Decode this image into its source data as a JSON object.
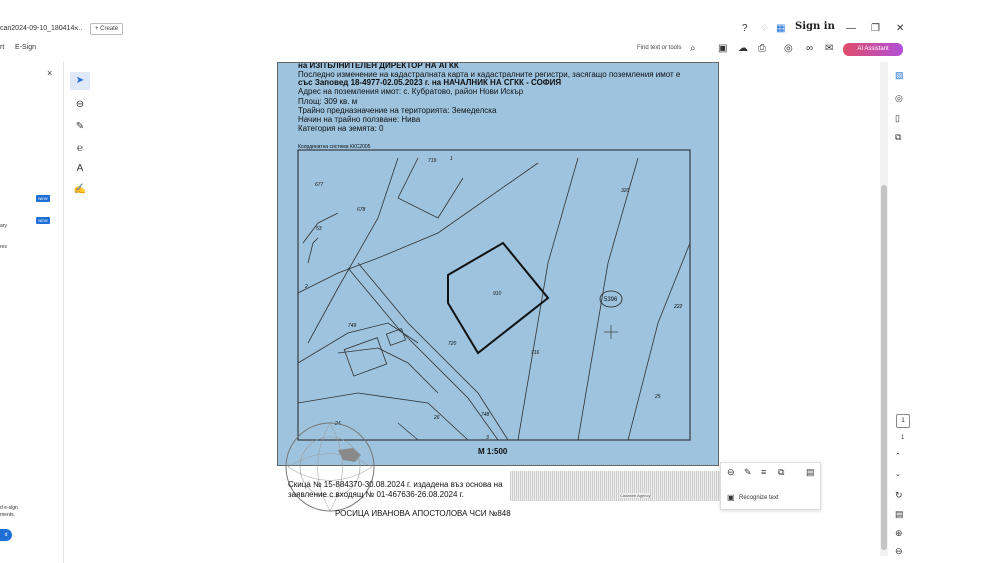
{
  "tab": {
    "title": "can2024-09-10_180414-...",
    "close": "×"
  },
  "create_label": "+ Create",
  "titlebar": {
    "sign_in": "Sign in",
    "min": "—",
    "max": "❐",
    "close": "✕"
  },
  "menu": {
    "items": [
      "rt",
      "E-Sign"
    ],
    "find_text": "Find text or tools",
    "ai_label": "AI Assistant"
  },
  "left_panel": {
    "close": "×",
    "new_badge_1": "NEW",
    "new_badge_2": "NEW",
    "row_1": "ary",
    "row_2": "res",
    "footer_1": "d e-sign",
    "footer_2": "ments.",
    "footer_btn": "d"
  },
  "document": {
    "lines": [
      "на ИЗПЪЛНИТЕЛЕН ДИРЕКТОР НА АГКК",
      "Последно изменение на кадастралната карта и кадастралните регистри, засягащо поземления имот е",
      "със Заповед 18-4977-02.05.2023 г. на НАЧАЛНИК НА СГКК - СОФИЯ",
      "Адрес на поземления имот: с. Кубратово, район Нови Искър",
      "Площ: 309 кв. м",
      "Трайно предназначение на територията: Земеделска",
      "Начин на трайно ползване: Нива",
      "Категория на земята: 0"
    ],
    "coord_system": "Координатна система ККС2005",
    "labels": {
      "l719": "719",
      "l1": "1",
      "l677": "677",
      "l678": "678",
      "l53": "53",
      "l320": "320",
      "l910": "910",
      "l5396": "5396",
      "l222": "222",
      "l2": "2",
      "l749": "749",
      "l720": "720",
      "l716": "716",
      "l25": "25",
      "l26": "26",
      "l748": "748",
      "l24": "24",
      "l3": "3"
    },
    "scale": "М 1:500",
    "footer_line_1": "Скица № 15-884370-30.08.2024 г. издадена въз основа на",
    "footer_line_2": "заявление с входящ № 01-467636-26.08.2024 г.",
    "footer_line_3": "РОСИЦА ИВАНОВА АПОСТОЛОВА ЧСИ №848",
    "note": "Cadastre Agency"
  },
  "popup": {
    "recognize": "Recognize text"
  },
  "pager": {
    "current": "1",
    "total": "1"
  },
  "colors": {
    "map_bg": "#9dc3de",
    "accent": "#1f6fd6",
    "ai_gradient_start": "#e04d6b",
    "ai_gradient_end": "#b14fd8"
  }
}
